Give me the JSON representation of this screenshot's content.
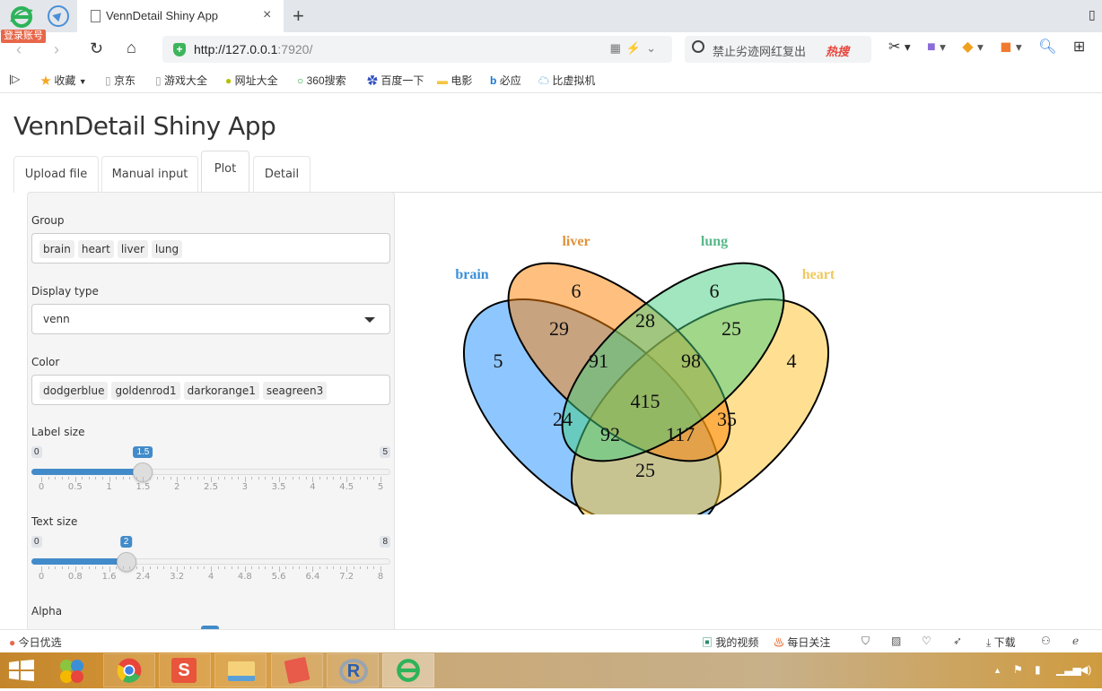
{
  "browser": {
    "login_badge": "登录账号",
    "tab_title": "VennDetail Shiny App",
    "tab_close": "×",
    "new_tab": "+",
    "url_host": "http://127.0.0.1",
    "url_rest": ":7920/",
    "search_placeholder": "禁止劣迹网红复出",
    "hot_search": "热搜",
    "bookmarks": [
      {
        "icon": "star-icon",
        "label": "收藏"
      },
      {
        "icon": "page-icon",
        "label": "京东"
      },
      {
        "icon": "page-icon",
        "label": "游戏大全"
      },
      {
        "icon": "site-icon",
        "label": "网址大全"
      },
      {
        "icon": "360-icon",
        "label": "360搜索"
      },
      {
        "icon": "baidu-icon",
        "label": "百度一下"
      },
      {
        "icon": "folder-icon",
        "label": "电影"
      },
      {
        "icon": "bing-icon",
        "label": "必应"
      },
      {
        "icon": "cloud-icon",
        "label": "比虚拟机"
      }
    ]
  },
  "app": {
    "title": "VennDetail Shiny App",
    "tabs": [
      {
        "label": "Upload file",
        "active": false
      },
      {
        "label": "Manual input",
        "active": false
      },
      {
        "label": "Plot",
        "active": true
      },
      {
        "label": "Detail",
        "active": false
      }
    ],
    "controls": {
      "group": {
        "label": "Group",
        "values": [
          "brain",
          "heart",
          "liver",
          "lung"
        ]
      },
      "display_type": {
        "label": "Display type",
        "value": "venn"
      },
      "color": {
        "label": "Color",
        "values": [
          "dodgerblue",
          "goldenrod1",
          "darkorange1",
          "seagreen3"
        ]
      },
      "label_size": {
        "label": "Label size",
        "min": 0,
        "max": 5,
        "value": 1.5,
        "min_label": "0",
        "max_label": "5",
        "value_label": "1.5",
        "ticks": [
          "0",
          "0.5",
          "1",
          "1.5",
          "2",
          "2.5",
          "3",
          "3.5",
          "4",
          "4.5",
          "5"
        ]
      },
      "text_size": {
        "label": "Text size",
        "min": 0,
        "max": 8,
        "value": 2,
        "min_label": "0",
        "max_label": "8",
        "value_label": "2",
        "ticks": [
          "0",
          "0.8",
          "1.6",
          "2.4",
          "3.2",
          "4",
          "4.8",
          "5.6",
          "6.4",
          "7.2",
          "8"
        ]
      },
      "alpha": {
        "label": "Alpha"
      }
    }
  },
  "chart_data": {
    "type": "venn",
    "sets": [
      {
        "name": "brain",
        "color": "#1e90ff"
      },
      {
        "name": "liver",
        "color": "#ff7f00"
      },
      {
        "name": "lung",
        "color": "#43cd80"
      },
      {
        "name": "heart",
        "color": "#ffc125"
      }
    ],
    "label_colors": {
      "brain": "#3a8fd9",
      "liver": "#e0923a",
      "lung": "#58b88a",
      "heart": "#f0c860"
    },
    "regions": [
      {
        "sets": [
          "brain"
        ],
        "value": 5
      },
      {
        "sets": [
          "liver"
        ],
        "value": 6
      },
      {
        "sets": [
          "lung"
        ],
        "value": 6
      },
      {
        "sets": [
          "heart"
        ],
        "value": 4
      },
      {
        "sets": [
          "brain",
          "liver"
        ],
        "value": 29
      },
      {
        "sets": [
          "liver",
          "lung"
        ],
        "value": 28
      },
      {
        "sets": [
          "lung",
          "heart"
        ],
        "value": 25
      },
      {
        "sets": [
          "brain",
          "liver",
          "lung"
        ],
        "value": 91
      },
      {
        "sets": [
          "liver",
          "lung",
          "heart"
        ],
        "value": 98
      },
      {
        "sets": [
          "brain",
          "liver",
          "lung",
          "heart"
        ],
        "value": 415
      },
      {
        "sets": [
          "brain",
          "lung"
        ],
        "value": 24
      },
      {
        "sets": [
          "liver",
          "heart"
        ],
        "value": 35
      },
      {
        "sets": [
          "brain",
          "lung",
          "heart"
        ],
        "value": 92
      },
      {
        "sets": [
          "brain",
          "liver",
          "heart"
        ],
        "value": 117
      },
      {
        "sets": [
          "brain",
          "heart"
        ],
        "value": 25
      }
    ]
  },
  "statusbar": {
    "left": "今日优选",
    "video": "我的视频",
    "follow": "每日关注",
    "download": "下载"
  }
}
